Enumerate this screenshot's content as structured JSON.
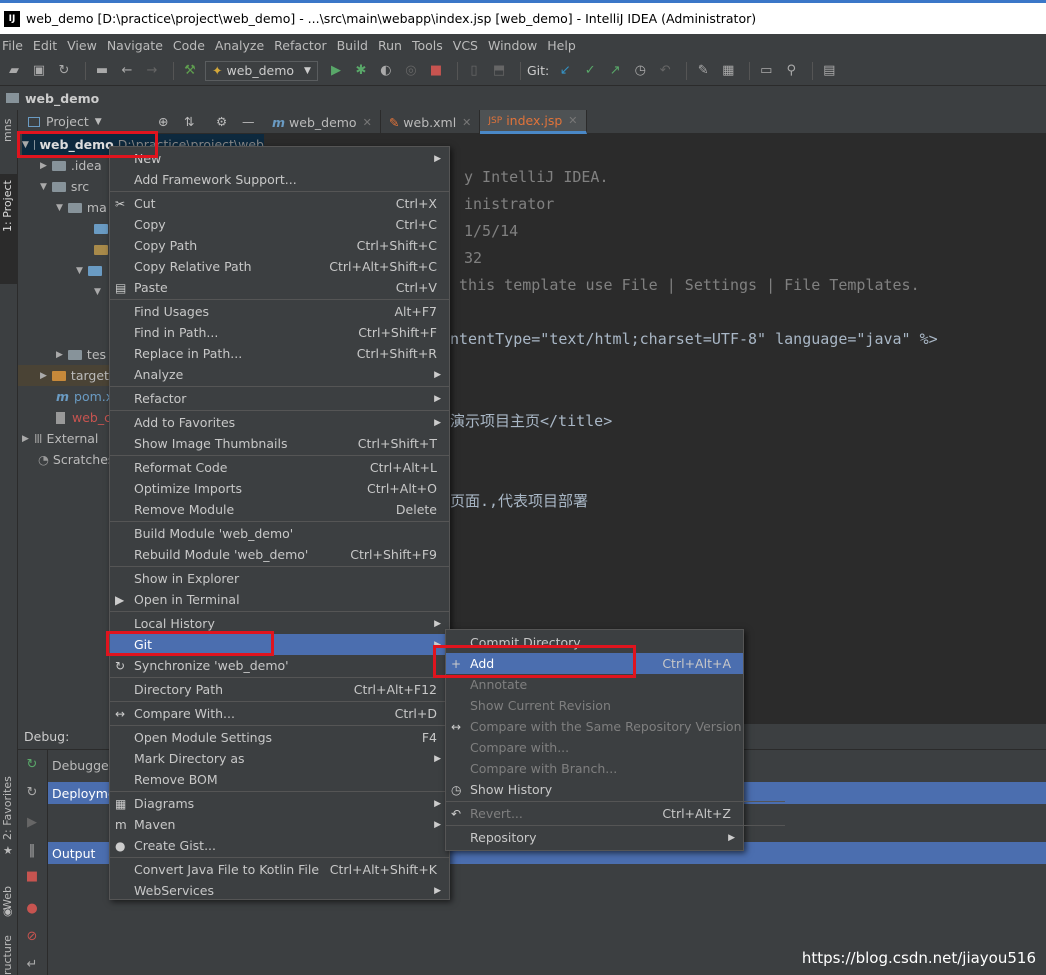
{
  "window": {
    "title": "web_demo [D:\\practice\\project\\web_demo] - ...\\src\\main\\webapp\\index.jsp [web_demo] - IntelliJ IDEA (Administrator)"
  },
  "menubar": [
    "File",
    "Edit",
    "View",
    "Navigate",
    "Code",
    "Analyze",
    "Refactor",
    "Build",
    "Run",
    "Tools",
    "VCS",
    "Window",
    "Help"
  ],
  "toolbar": {
    "run_config": "web_demo",
    "git_label": "Git:"
  },
  "navbar": {
    "project": "web_demo"
  },
  "left_tabs": {
    "project": "1: Project",
    "favorites": "2: Favorites",
    "web": "Web",
    "structure": "ructure",
    "mns": "mns"
  },
  "project_panel": {
    "header": "Project",
    "root": "web_demo",
    "root_path": "D:\\practice\\project\\web",
    "items": [
      ".idea",
      "src",
      "ma",
      "tes",
      "target",
      "pom.x",
      "web_c",
      "External",
      "Scratches"
    ]
  },
  "editor_tabs": [
    {
      "label": "web_demo"
    },
    {
      "label": "web.xml"
    },
    {
      "label": "index.jsp"
    }
  ],
  "editor": {
    "lines": [
      {
        "text": "y IntelliJ IDEA."
      },
      {
        "text": "inistrator"
      },
      {
        "text": "1/5/14"
      },
      {
        "text": "32"
      },
      {
        "text": " this template use File | Settings | File Templates."
      },
      {
        "text": "ntentType=\"text/html;charset=UTF-8\" language=\"java\" %>"
      },
      {
        "text": "演示项目主页</title>"
      },
      {
        "text": "页面.,代表项目部署"
      }
    ]
  },
  "debug": {
    "label": "Debug:",
    "debugger": "Debugger",
    "deployment": "Deploymen",
    "output": "Output"
  },
  "context_menu": [
    {
      "label": "New",
      "submenu": true
    },
    {
      "label": "Add Framework Support..."
    },
    {
      "sep": true
    },
    {
      "label": "Cut",
      "shortcut": "Ctrl+X",
      "icon": "scissors-icon"
    },
    {
      "label": "Copy",
      "shortcut": "Ctrl+C"
    },
    {
      "label": "Copy Path",
      "shortcut": "Ctrl+Shift+C"
    },
    {
      "label": "Copy Relative Path",
      "shortcut": "Ctrl+Alt+Shift+C"
    },
    {
      "label": "Paste",
      "shortcut": "Ctrl+V",
      "icon": "paste-icon"
    },
    {
      "sep": true
    },
    {
      "label": "Find Usages",
      "shortcut": "Alt+F7"
    },
    {
      "label": "Find in Path...",
      "shortcut": "Ctrl+Shift+F"
    },
    {
      "label": "Replace in Path...",
      "shortcut": "Ctrl+Shift+R"
    },
    {
      "label": "Analyze",
      "submenu": true
    },
    {
      "sep": true
    },
    {
      "label": "Refactor",
      "submenu": true
    },
    {
      "sep": true
    },
    {
      "label": "Add to Favorites",
      "submenu": true
    },
    {
      "label": "Show Image Thumbnails",
      "shortcut": "Ctrl+Shift+T"
    },
    {
      "sep": true
    },
    {
      "label": "Reformat Code",
      "shortcut": "Ctrl+Alt+L"
    },
    {
      "label": "Optimize Imports",
      "shortcut": "Ctrl+Alt+O"
    },
    {
      "label": "Remove Module",
      "shortcut": "Delete"
    },
    {
      "sep": true
    },
    {
      "label": "Build Module 'web_demo'"
    },
    {
      "label": "Rebuild Module 'web_demo'",
      "shortcut": "Ctrl+Shift+F9"
    },
    {
      "sep": true
    },
    {
      "label": "Show in Explorer"
    },
    {
      "label": "Open in Terminal",
      "icon": "terminal-icon"
    },
    {
      "sep": true
    },
    {
      "label": "Local History",
      "submenu": true
    },
    {
      "label": "Git",
      "submenu": true,
      "highlight": true
    },
    {
      "label": "Synchronize 'web_demo'",
      "icon": "sync-icon"
    },
    {
      "sep": true
    },
    {
      "label": "Directory Path",
      "shortcut": "Ctrl+Alt+F12"
    },
    {
      "sep": true
    },
    {
      "label": "Compare With...",
      "shortcut": "Ctrl+D",
      "icon": "compare-icon"
    },
    {
      "sep": true
    },
    {
      "label": "Open Module Settings",
      "shortcut": "F4"
    },
    {
      "label": "Mark Directory as",
      "submenu": true
    },
    {
      "label": "Remove BOM"
    },
    {
      "sep": true
    },
    {
      "label": "Diagrams",
      "submenu": true,
      "icon": "diagram-icon"
    },
    {
      "label": "Maven",
      "submenu": true,
      "icon": "maven-icon"
    },
    {
      "label": "Create Gist...",
      "icon": "github-icon"
    },
    {
      "sep": true
    },
    {
      "label": "Convert Java File to Kotlin File",
      "shortcut": "Ctrl+Alt+Shift+K"
    },
    {
      "label": "WebServices",
      "submenu": true
    }
  ],
  "git_submenu": [
    {
      "label": "Commit Directory..."
    },
    {
      "label": "Add",
      "shortcut": "Ctrl+Alt+A",
      "highlight": true,
      "icon": "plus-icon"
    },
    {
      "label": "Annotate",
      "disabled": true
    },
    {
      "label": "Show Current Revision",
      "disabled": true
    },
    {
      "label": "Compare with the Same Repository Version",
      "disabled": true,
      "icon": "compare-icon"
    },
    {
      "label": "Compare with...",
      "disabled": true
    },
    {
      "label": "Compare with Branch...",
      "disabled": true
    },
    {
      "label": "Show History",
      "icon": "history-icon"
    },
    {
      "sep": true
    },
    {
      "label": "Revert...",
      "shortcut": "Ctrl+Alt+Z",
      "disabled": true,
      "icon": "revert-icon"
    },
    {
      "sep": true
    },
    {
      "label": "Repository",
      "submenu": true
    }
  ],
  "watermark": "https://blog.csdn.net/jiayou516",
  "colors": {
    "highlight": "#4b6eaf",
    "annotation_red": "#e0141e",
    "background": "#2b2b2b",
    "panel": "#3c3f41"
  }
}
